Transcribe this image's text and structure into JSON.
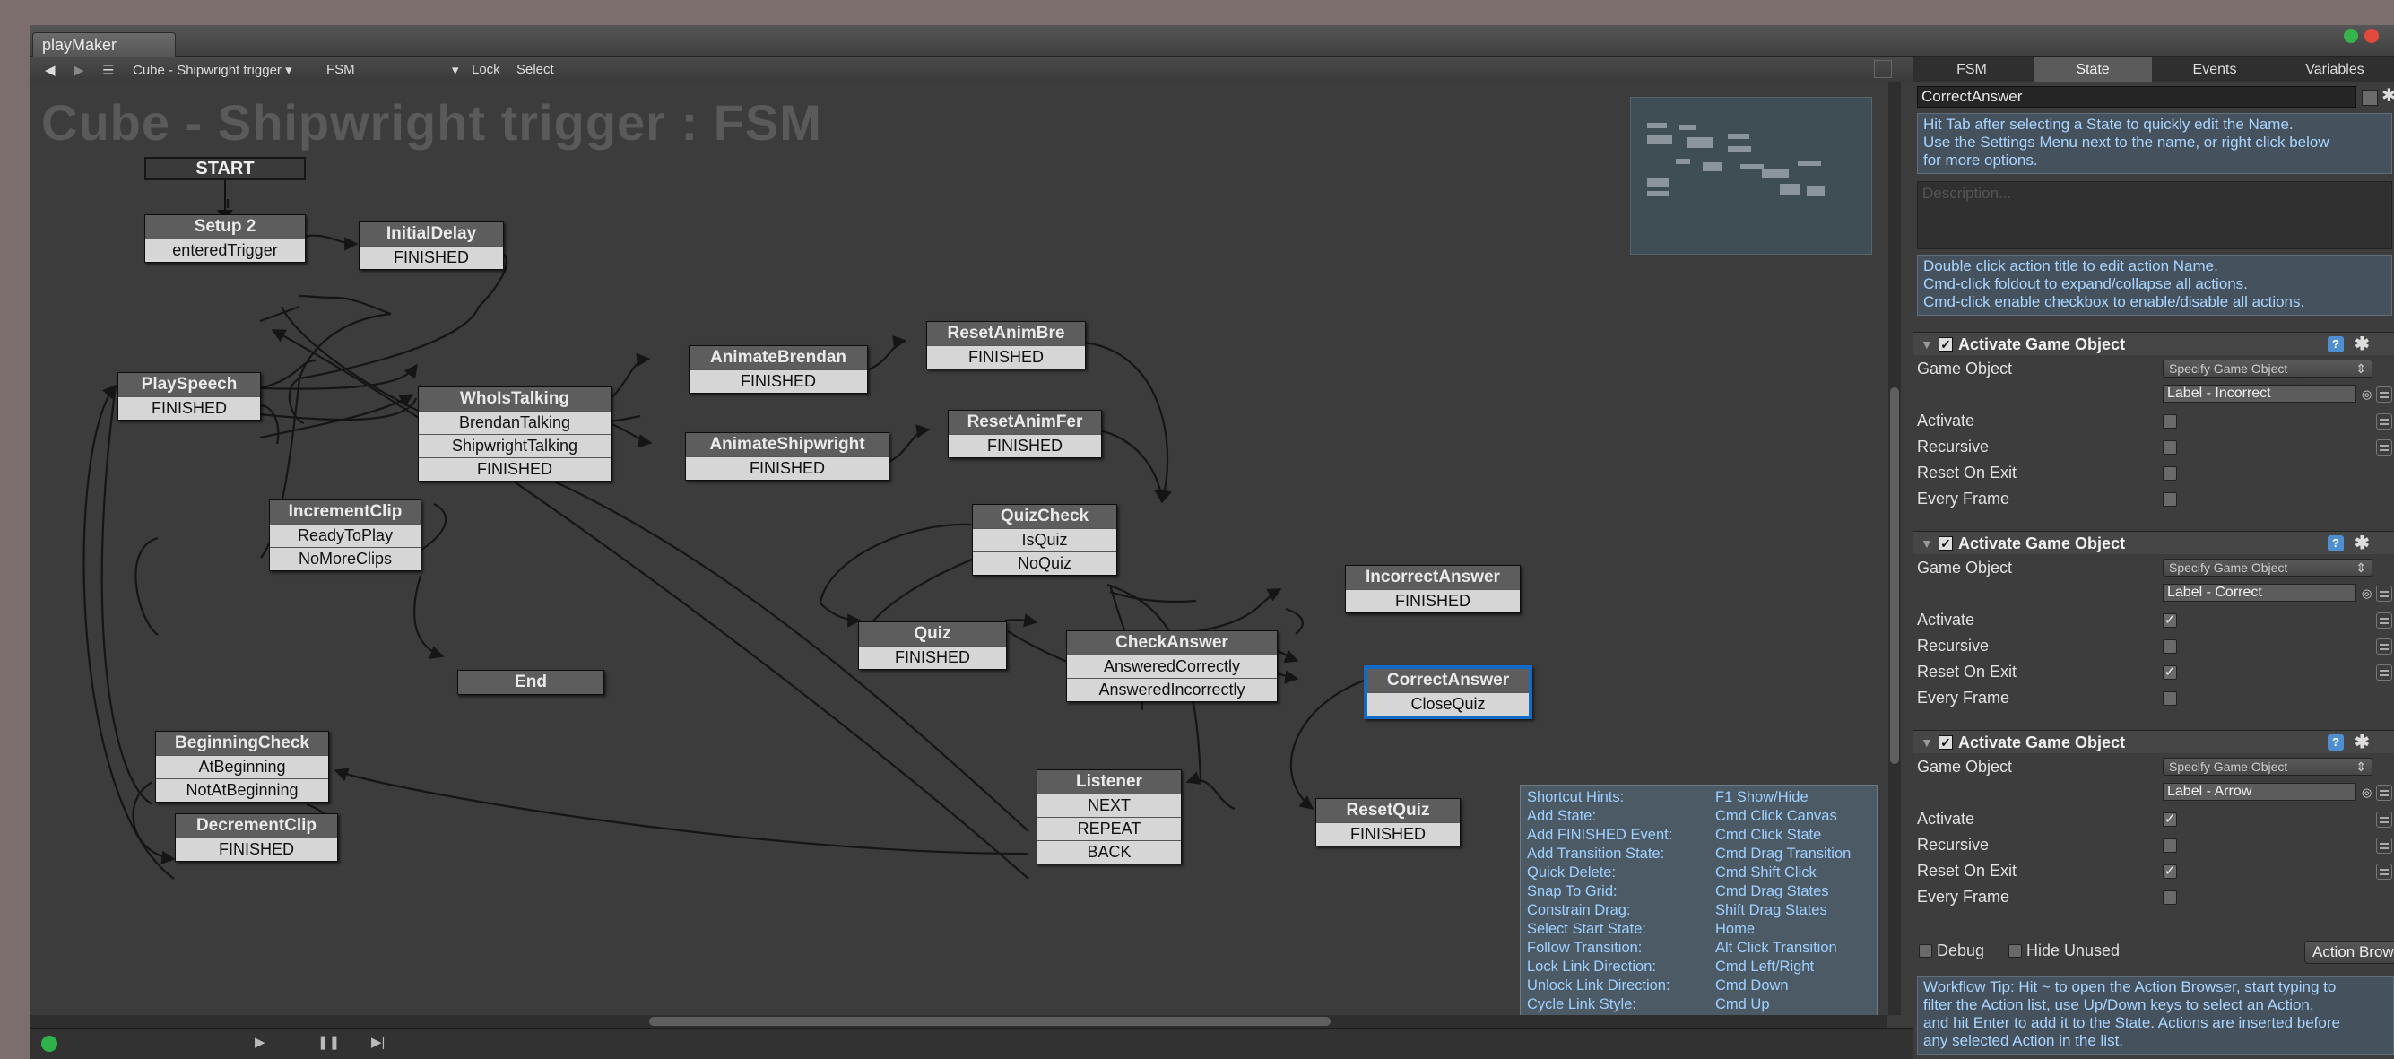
{
  "window": {
    "tab_title": "playMaker",
    "close_color": "#e24a3b",
    "min_color": "#36b34a"
  },
  "toolbar": {
    "fsm_selector": "Cube - Shipwright trigger",
    "fsm_name": "FSM",
    "lock": "Lock",
    "select": "Select"
  },
  "canvas": {
    "title": "Cube - Shipwright trigger : FSM",
    "start_label": "START",
    "end_label": "End"
  },
  "states": {
    "setup2": {
      "name": "Setup 2",
      "events": [
        "enteredTrigger"
      ]
    },
    "initialdelay": {
      "name": "InitialDelay",
      "events": [
        "FINISHED"
      ]
    },
    "playspeech": {
      "name": "PlaySpeech",
      "events": [
        "FINISHED"
      ]
    },
    "whoistalking": {
      "name": "WhoIsTalking",
      "events": [
        "BrendanTalking",
        "ShipwrightTalking",
        "FINISHED"
      ]
    },
    "animatebrendan": {
      "name": "AnimateBrendan",
      "events": [
        "FINISHED"
      ]
    },
    "animateshipwright": {
      "name": "AnimateShipwright",
      "events": [
        "FINISHED"
      ]
    },
    "resetanimbre": {
      "name": "ResetAnimBre",
      "events": [
        "FINISHED"
      ]
    },
    "resetanimfer": {
      "name": "ResetAnimFer",
      "events": [
        "FINISHED"
      ]
    },
    "incrementclip": {
      "name": "IncrementClip",
      "events": [
        "ReadyToPlay",
        "NoMoreClips"
      ]
    },
    "quizcheck": {
      "name": "QuizCheck",
      "events": [
        "IsQuiz",
        "NoQuiz"
      ]
    },
    "quiz": {
      "name": "Quiz",
      "events": [
        "FINISHED"
      ]
    },
    "checkanswer": {
      "name": "CheckAnswer",
      "events": [
        "AnsweredCorrectly",
        "AnsweredIncorrectly"
      ]
    },
    "incorrectanswer": {
      "name": "IncorrectAnswer",
      "events": [
        "FINISHED"
      ]
    },
    "correctanswer": {
      "name": "CorrectAnswer",
      "events": [
        "CloseQuiz"
      ]
    },
    "beginningcheck": {
      "name": "BeginningCheck",
      "events": [
        "AtBeginning",
        "NotAtBeginning"
      ]
    },
    "decrementclip": {
      "name": "DecrementClip",
      "events": [
        "FINISHED"
      ]
    },
    "listener": {
      "name": "Listener",
      "events": [
        "NEXT",
        "REPEAT",
        "BACK"
      ]
    },
    "resetquiz": {
      "name": "ResetQuiz",
      "events": [
        "FINISHED"
      ]
    }
  },
  "hints": [
    {
      "label": "Shortcut Hints:",
      "key": "F1 Show/Hide"
    },
    {
      "label": "Add State:",
      "key": "Cmd Click Canvas"
    },
    {
      "label": "Add FINISHED Event:",
      "key": "Cmd Click State"
    },
    {
      "label": "Add Transition State:",
      "key": "Cmd Drag Transition"
    },
    {
      "label": "Quick Delete:",
      "key": "Cmd Shift Click"
    },
    {
      "label": "Snap To Grid:",
      "key": "Cmd Drag States"
    },
    {
      "label": "Constrain Drag:",
      "key": "Shift Drag States"
    },
    {
      "label": "Select Start State:",
      "key": "Home"
    },
    {
      "label": "Follow Transition:",
      "key": "Alt Click Transition"
    },
    {
      "label": "Lock Link Direction:",
      "key": "Cmd Left/Right"
    },
    {
      "label": "Unlock Link Direction:",
      "key": "Cmd Down"
    },
    {
      "label": "Cycle Link Style:",
      "key": "Cmd Up"
    }
  ],
  "inspector": {
    "tabs": [
      "FSM",
      "State",
      "Events",
      "Variables"
    ],
    "active_tab": "State",
    "state_name": "CorrectAnswer",
    "tip1": [
      "Hit Tab after selecting a State to quickly edit the Name.",
      "Use the Settings Menu next to the name, or right click below",
      "for more options."
    ],
    "description_placeholder": "Description...",
    "tip2": [
      "Double click action title to edit action Name.",
      "Cmd-click foldout to expand/collapse all actions.",
      "Cmd-click enable checkbox to enable/disable all actions."
    ],
    "actions": [
      {
        "title": "Activate Game Object",
        "game_object_label": "Game Object",
        "game_object_mode": "Specify Game Object",
        "game_object": "Label - Incorrect",
        "props": [
          {
            "label": "Activate",
            "checked": false
          },
          {
            "label": "Recursive",
            "checked": false
          },
          {
            "label": "Reset On Exit",
            "checked": false
          },
          {
            "label": "Every Frame",
            "checked": false
          }
        ]
      },
      {
        "title": "Activate Game Object",
        "game_object_label": "Game Object",
        "game_object_mode": "Specify Game Object",
        "game_object": "Label - Correct",
        "props": [
          {
            "label": "Activate",
            "checked": true
          },
          {
            "label": "Recursive",
            "checked": false
          },
          {
            "label": "Reset On Exit",
            "checked": true
          },
          {
            "label": "Every Frame",
            "checked": false
          }
        ]
      },
      {
        "title": "Activate Game Object",
        "game_object_label": "Game Object",
        "game_object_mode": "Specify Game Object",
        "game_object": "Label - Arrow",
        "props": [
          {
            "label": "Activate",
            "checked": true
          },
          {
            "label": "Recursive",
            "checked": false
          },
          {
            "label": "Reset On Exit",
            "checked": true
          },
          {
            "label": "Every Frame",
            "checked": false
          }
        ]
      }
    ],
    "debug_label": "Debug",
    "hide_unused_label": "Hide Unused",
    "action_browser_label": "Action Browser",
    "workflow_tip": [
      "Workflow Tip: Hit ~ to open the Action Browser, start typing to",
      "filter the Action list, use Up/Down keys to select an Action,",
      "and hit Enter to add it to the State. Actions are inserted before",
      "any selected Action in the list."
    ]
  }
}
